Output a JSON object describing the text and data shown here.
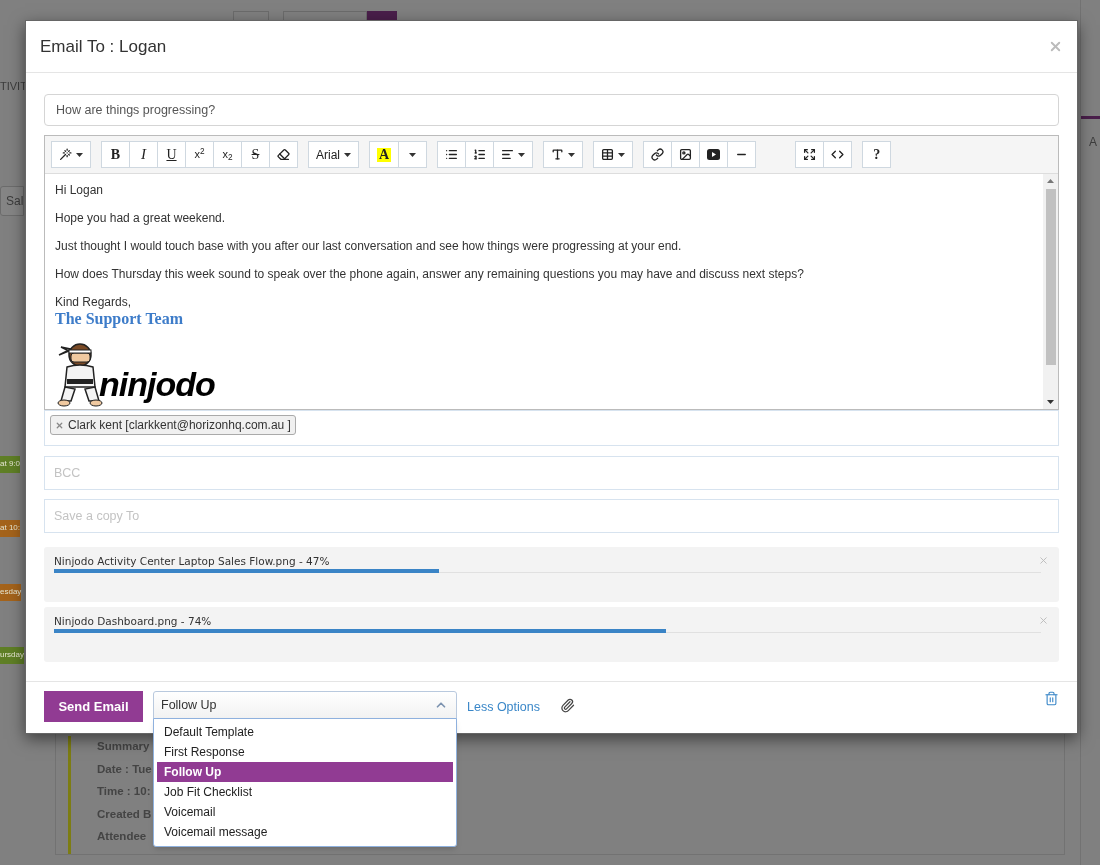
{
  "background": {
    "left_items": [
      {
        "kind": "text",
        "label": "TIVIT"
      },
      {
        "kind": "button",
        "label": "Sal"
      },
      {
        "kind": "tag",
        "label": "at 9:0",
        "color": "#5f7f26"
      },
      {
        "kind": "tag",
        "label": "at 10:",
        "color": "#a4631b"
      },
      {
        "kind": "tag",
        "label": "esday",
        "color": "#a4631b"
      },
      {
        "kind": "tag",
        "label": "ursday",
        "color": "#5f7f26"
      }
    ],
    "right_label": "A",
    "details": [
      "Summary",
      "Date : Tue",
      "Time : 10:",
      "Created B",
      "Attendee"
    ]
  },
  "dialog": {
    "title": "Email To : Logan",
    "subject": "How are things progressing?",
    "toolbar": [
      [
        {
          "kind": "icon",
          "caret": true
        }
      ],
      [
        {
          "kind": "text",
          "label": "B"
        },
        {
          "kind": "text",
          "label": "I"
        },
        {
          "kind": "text",
          "label": "U"
        },
        {
          "kind": "text",
          "label": "x$^{2}$"
        },
        {
          "kind": "text",
          "label": "x$_{2}$"
        },
        {
          "kind": "text",
          "label": "S"
        },
        {
          "kind": "icon"
        }
      ],
      [
        {
          "kind": "text",
          "label": "Arial",
          "caret": true
        }
      ],
      [
        {
          "kind": "text",
          "label": "A"
        },
        {
          "kind": "caret"
        }
      ],
      [
        {
          "kind": "icon"
        },
        {
          "kind": "icon"
        },
        {
          "kind": "icon",
          "caret": true
        }
      ],
      [
        {
          "kind": "icon",
          "caret": true
        }
      ],
      [
        {
          "kind": "icon",
          "caret": true
        }
      ],
      [
        {
          "kind": "icon"
        },
        {
          "kind": "icon"
        },
        {
          "kind": "icon"
        },
        {
          "kind": "icon"
        }
      ],
      [
        {
          "kind": "icon"
        },
        {
          "kind": "icon"
        }
      ],
      [
        {
          "kind": "text",
          "label": "?"
        }
      ]
    ],
    "body": {
      "paragraphs": [
        "Hi Logan",
        "Hope you had a great weekend.",
        "Just thought I would touch base with you after our last conversation and see how things were progressing at your end.",
        "How does Thursday this week sound to speak over the phone again, answer any remaining questions you may have and discuss next steps?"
      ],
      "closing": "Kind Regards,",
      "signature": "The Support Team",
      "logo_text": "ninjodo"
    },
    "to": {
      "recipients": [
        "Clark kent [clarkkent@horizonhq.com.au ]"
      ]
    },
    "bcc": {
      "placeholder": "BCC"
    },
    "save_copy": {
      "placeholder": "Save a copy To"
    },
    "attachments": [
      {
        "name": "Ninjodo Activity Center Laptop Sales Flow.png - 47%",
        "level": 0.39
      },
      {
        "name": "Ninjodo Dashboard.png - 74%",
        "level": 0.62
      }
    ],
    "footer": {
      "send": "Send Email",
      "template": {
        "value": "Follow Up",
        "expanded": true,
        "options": [
          {
            "label": "Default Template",
            "selected": false
          },
          {
            "label": "First Response",
            "selected": false
          },
          {
            "label": "Follow Up",
            "selected": true
          },
          {
            "label": "Job Fit Checklist",
            "selected": false
          },
          {
            "label": "Voicemail",
            "selected": false
          },
          {
            "label": "Voicemail message",
            "selected": false
          }
        ]
      },
      "less_options": "Less Options"
    }
  }
}
